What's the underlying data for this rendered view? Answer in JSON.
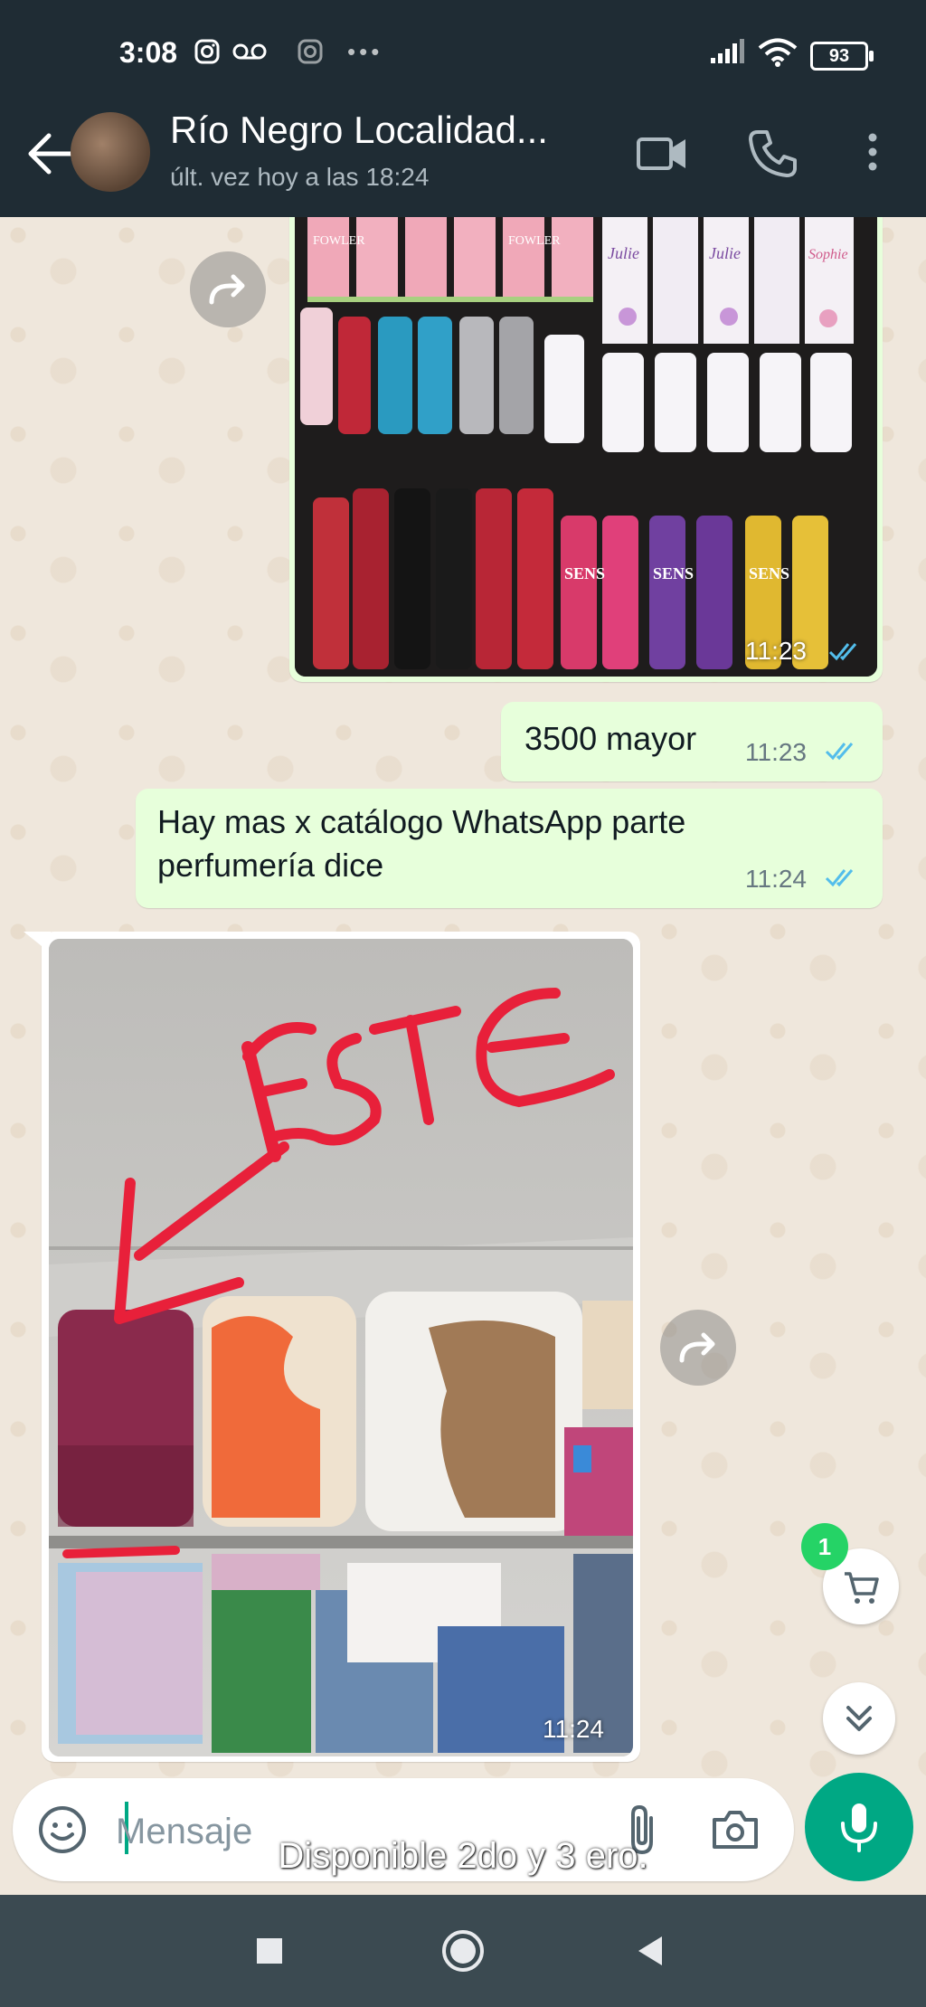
{
  "status_bar": {
    "time": "3:08",
    "battery": "93"
  },
  "header": {
    "contact_name": "Río Negro Localidad...",
    "last_seen": "últ. vez hoy a las 18:24"
  },
  "messages": [
    {
      "type": "image",
      "direction": "out",
      "subject": "perfume bottles on shelf",
      "time": "11:23",
      "status": "read"
    },
    {
      "type": "text",
      "direction": "out",
      "text": "3500 mayor",
      "time": "11:23",
      "status": "read"
    },
    {
      "type": "text",
      "direction": "out",
      "text_line1": "Hay mas x catálogo WhatsApp parte",
      "text_line2": "perfumería dice",
      "time": "11:24",
      "status": "read"
    },
    {
      "type": "image",
      "direction": "in",
      "subject": "bedding packs on shelf",
      "annotation": "ESTE",
      "time": "11:24"
    }
  ],
  "image_labels": {
    "fowler_brand": "FOWLER",
    "julie_brand": "Julie",
    "sophie_brand": "Sophie",
    "sens_brand": "SENS"
  },
  "cart": {
    "badge_count": "1"
  },
  "composer": {
    "placeholder": "Mensaje"
  },
  "caption": "Disponible 2do y 3 ero.",
  "colors": {
    "header_bg": "#1f2c34",
    "outgoing_bubble": "#e7ffdb",
    "accent": "#00a884",
    "read_ticks": "#53bdeb"
  },
  "icons": [
    "back-arrow-icon",
    "video-call-icon",
    "phone-icon",
    "more-icon",
    "forward-icon",
    "cart-icon",
    "chevron-double-down-icon",
    "emoji-icon",
    "attach-icon",
    "camera-icon",
    "mic-icon",
    "nav-square-icon",
    "nav-circle-icon",
    "nav-back-icon"
  ]
}
